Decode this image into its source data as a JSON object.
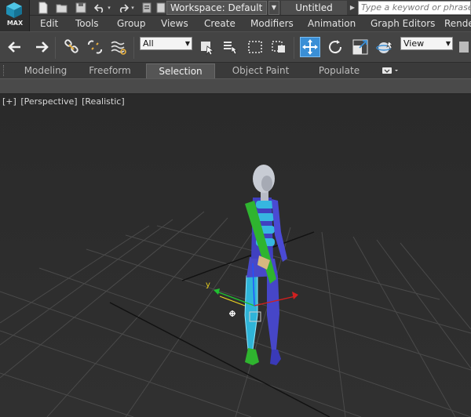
{
  "app": {
    "logo_text": "MAX",
    "workspace_label": "Workspace: Default",
    "document_title": "Untitled",
    "search_placeholder": "Type a keyword or phrase"
  },
  "menu": [
    "Edit",
    "Tools",
    "Group",
    "Views",
    "Create",
    "Modifiers",
    "Animation",
    "Graph Editors",
    "Rende"
  ],
  "toolbar": {
    "selection_filter": "All",
    "reference_coord": "View"
  },
  "ribbon": {
    "tabs": [
      "Modeling",
      "Freeform",
      "Selection",
      "Object Paint",
      "Populate"
    ],
    "active_tab": "Selection"
  },
  "viewport": {
    "labels": [
      "[+]",
      "[Perspective]",
      "[Realistic]"
    ],
    "gizmo_axis_label": "y"
  },
  "colors": {
    "accent_active": "#3a8fd6",
    "axis_x": "#d02020",
    "axis_y": "#20c030",
    "axis_z": "#2050ff",
    "biped_left": "#4a4ad0",
    "biped_right": "#2fb42f",
    "spine": "#36b6e0",
    "head": "#c8ccd4"
  }
}
